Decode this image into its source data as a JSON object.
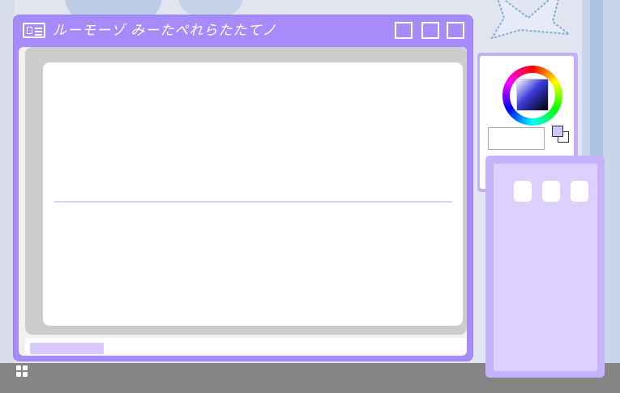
{
  "window": {
    "title": "ルーモーゾ みーたぺれらたたてノ",
    "controls": [
      "minimize",
      "maximize",
      "close"
    ]
  },
  "color_picker": {
    "hex_value": "",
    "foreground_color": "#c9c9fa",
    "background_color": "#ffffff"
  },
  "colors": {
    "window_frame": "#a78bfa",
    "side_panel": "#c5b3fb",
    "side_panel_inner": "#ddd0ff",
    "scroll_thumb": "#d8c9ff",
    "canvas": "#ffffff",
    "canvas_border": "#cccccc",
    "taskbar": "#858585"
  },
  "icons": {
    "app": "window-icon",
    "start": "grid-icon"
  }
}
